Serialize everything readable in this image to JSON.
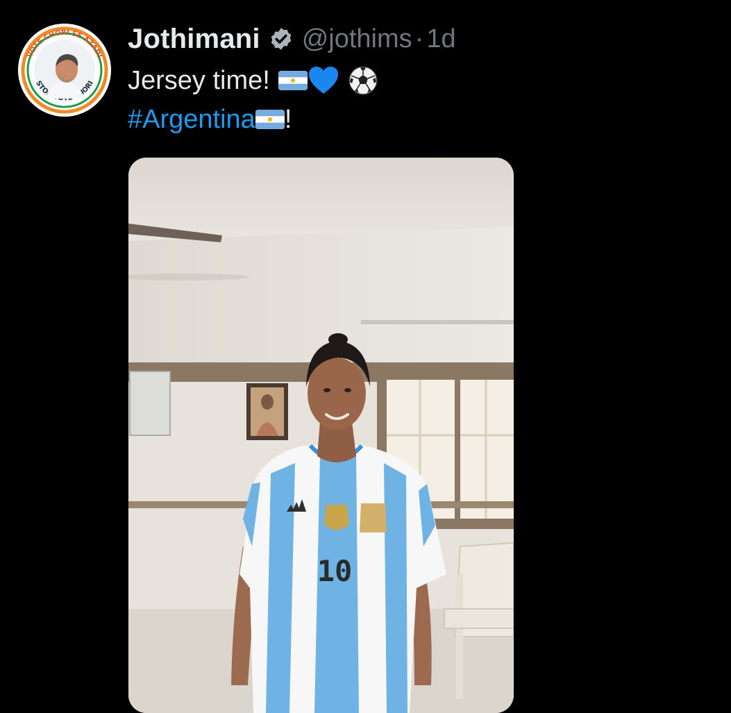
{
  "tweet": {
    "display_name": "Jothimani",
    "handle": "@jothims",
    "separator": "·",
    "time": "1d",
    "text_line1": "Jersey time!",
    "hashtag": "#Argentina",
    "trailing": "!"
  },
  "avatar": {
    "ring_text_top": "VOTE CHORI SE AZADI",
    "ring_text_bottom": "STOP VOTE CHORI"
  },
  "photo": {
    "jersey_number": "10"
  },
  "icons": {
    "verified": "verified-badge-icon",
    "flag": "argentina-flag-icon",
    "heart": "blue-heart-icon",
    "ball": "soccer-ball-icon"
  },
  "colors": {
    "background": "#000000",
    "text": "#e7e9ea",
    "muted": "#71767b",
    "link": "#1d9bf0",
    "jersey_blue": "#6fb3e4"
  }
}
